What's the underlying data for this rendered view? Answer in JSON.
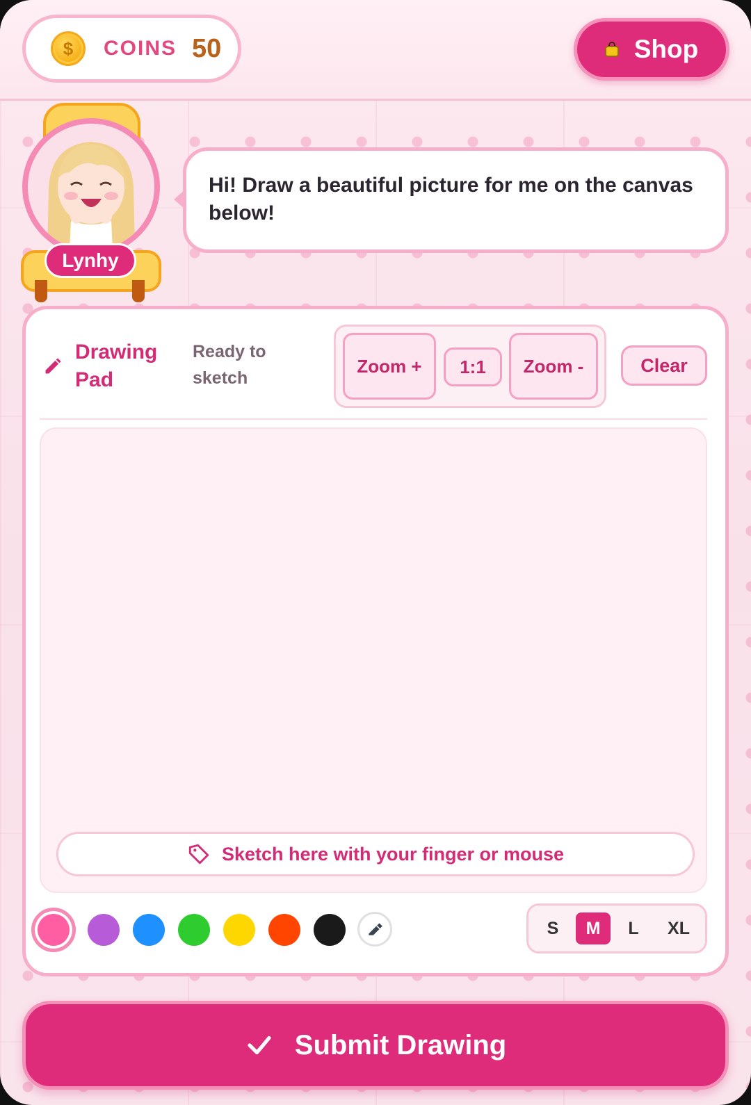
{
  "header": {
    "coins_label": "COINS",
    "coins_value": "50",
    "shop_label": "Shop"
  },
  "character": {
    "name": "Lynhy",
    "message": "Hi! Draw a beautiful picture for me on the canvas below!"
  },
  "drawing_pad": {
    "title": "Drawing Pad",
    "status": "Ready to sketch",
    "zoom_in_label": "Zoom +",
    "reset_zoom_label": "1:1",
    "zoom_out_label": "Zoom -",
    "clear_label": "Clear",
    "canvas_hint": "Sketch here with your finger or mouse"
  },
  "palette": {
    "selected": "#ff5fa2",
    "colors": [
      "#ff5fa2",
      "#b75bd8",
      "#1e90ff",
      "#2ecc2e",
      "#ffd700",
      "#ff4500",
      "#1a1a1a"
    ],
    "eraser_icon": "eraser-icon"
  },
  "brush_sizes": {
    "options": [
      "S",
      "M",
      "L",
      "XL"
    ],
    "selected": "M"
  },
  "submit_label": "Submit Drawing",
  "colors": {
    "accent": "#de2c7a",
    "accent_light": "#f7aecb",
    "background": "#fbe6ee"
  }
}
